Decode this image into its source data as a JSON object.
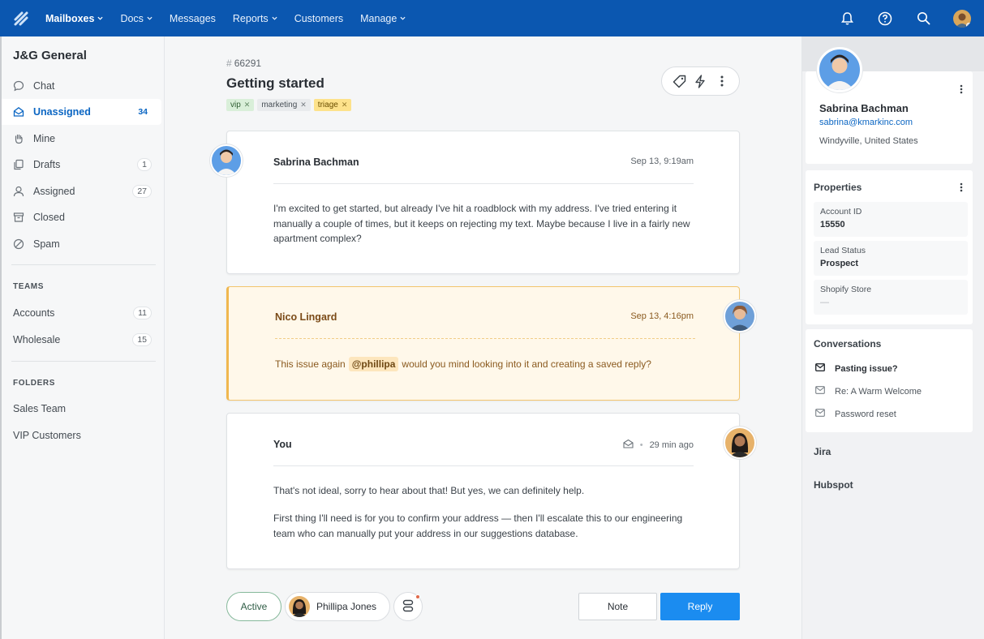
{
  "nav": {
    "items": [
      {
        "label": "Mailboxes",
        "dropdown": true,
        "active": true
      },
      {
        "label": "Docs",
        "dropdown": true
      },
      {
        "label": "Messages",
        "dropdown": false
      },
      {
        "label": "Reports",
        "dropdown": true
      },
      {
        "label": "Customers",
        "dropdown": false
      },
      {
        "label": "Manage",
        "dropdown": true
      }
    ],
    "icons": [
      "bell-icon",
      "help-icon",
      "search-icon",
      "user-avatar"
    ]
  },
  "sidebar": {
    "title": "J&G General",
    "items": [
      {
        "label": "Chat",
        "icon": "chat-icon",
        "count": ""
      },
      {
        "label": "Unassigned",
        "icon": "inbox-icon",
        "count": "34",
        "active": true
      },
      {
        "label": "Mine",
        "icon": "hand-icon",
        "count": ""
      },
      {
        "label": "Drafts",
        "icon": "drafts-icon",
        "count": "1"
      },
      {
        "label": "Assigned",
        "icon": "person-icon",
        "count": "27"
      },
      {
        "label": "Closed",
        "icon": "archive-icon",
        "count": ""
      },
      {
        "label": "Spam",
        "icon": "ban-icon",
        "count": ""
      }
    ],
    "teams_heading": "TEAMS",
    "teams": [
      {
        "label": "Accounts",
        "count": "11"
      },
      {
        "label": "Wholesale",
        "count": "15"
      }
    ],
    "folders_heading": "FOLDERS",
    "folders": [
      {
        "label": "Sales Team"
      },
      {
        "label": "VIP Customers"
      }
    ]
  },
  "ticket": {
    "number_prefix": "#",
    "number": "66291",
    "title": "Getting started",
    "tags": [
      {
        "label": "vip",
        "color": "#d9efd9"
      },
      {
        "label": "marketing",
        "color": "#e9ebed"
      },
      {
        "label": "triage",
        "color": "#fde28b"
      }
    ]
  },
  "thread": {
    "messages": [
      {
        "author": "Sabrina Bachman",
        "time": "Sep 13, 9:19am",
        "body": "I'm excited to get started, but already I've hit a roadblock with my address. I've tried entering it manually a couple of times, but it keeps on rejecting my text. Maybe because I live in a fairly new apartment complex?"
      },
      {
        "author": "Nico Lingard",
        "time": "Sep 13, 4:16pm",
        "body_before": "This issue again",
        "mention": "@phillipa",
        "body_after": "would you mind looking into it and creating a saved reply?"
      },
      {
        "author": "You",
        "time": "29 min ago",
        "body_p1": "That's not ideal, sorry to hear about that! But yes, we can definitely help.",
        "body_p2": "First thing I'll need is for you to confirm your address — then I'll escalate this to our engineering team who can manually put your address in our suggestions database."
      }
    ]
  },
  "footer": {
    "status": "Active",
    "assignee": "Phillipa Jones",
    "note_label": "Note",
    "reply_label": "Reply"
  },
  "customer": {
    "name": "Sabrina Bachman",
    "email": "sabrina@kmarkinc.com",
    "location": "Windyville, United States"
  },
  "properties": {
    "title": "Properties",
    "items": [
      {
        "label": "Account ID",
        "value": "15550"
      },
      {
        "label": "Lead Status",
        "value": "Prospect"
      },
      {
        "label": "Shopify Store",
        "value": "—"
      }
    ]
  },
  "conversations": {
    "title": "Conversations",
    "items": [
      {
        "label": "Pasting issue?",
        "current": true
      },
      {
        "label": "Re: A Warm Welcome",
        "current": false
      },
      {
        "label": "Password reset",
        "current": false
      }
    ]
  },
  "integrations": [
    {
      "label": "Jira"
    },
    {
      "label": "Hubspot"
    }
  ],
  "colors": {
    "brand": "#0b57b0",
    "reply": "#1b8cf0",
    "note_border": "#f0b74f",
    "active_accent": "#0b66c3"
  }
}
